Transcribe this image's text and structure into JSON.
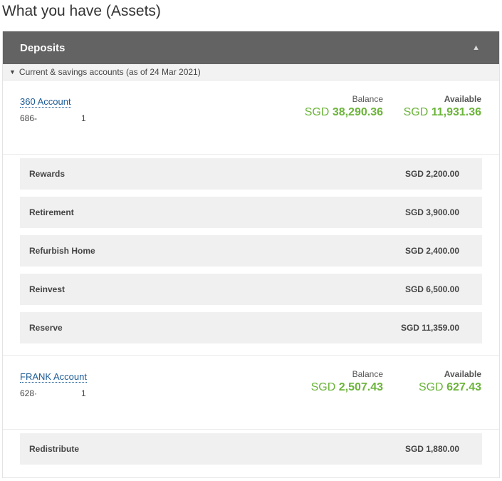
{
  "page": {
    "title": "What you have (Assets)"
  },
  "panel": {
    "title": "Deposits",
    "collapse_icon": "triangle-up-icon"
  },
  "section": {
    "label": "Current & savings accounts (as of 24 Mar 2021)",
    "expand_icon": "triangle-down-icon"
  },
  "colors": {
    "accent_green": "#6bb43a",
    "link_blue": "#1a5a96",
    "header_gray": "#636363"
  },
  "accounts": [
    {
      "name": "360 Account",
      "number_prefix": "686-",
      "number_suffix": "1",
      "balance_label": "Balance",
      "available_label": "Available",
      "balance_currency": "SGD",
      "balance_amount": "38,290.36",
      "available_currency": "SGD",
      "available_amount": "11,931.36",
      "goals": [
        {
          "label": "Rewards",
          "amount": "SGD 2,200.00"
        },
        {
          "label": "Retirement",
          "amount": "SGD 3,900.00"
        },
        {
          "label": "Refurbish Home",
          "amount": "SGD 2,400.00"
        },
        {
          "label": "Reinvest",
          "amount": "SGD 6,500.00"
        },
        {
          "label": "Reserve",
          "amount": "SGD 11,359.00"
        }
      ]
    },
    {
      "name": "FRANK Account",
      "number_prefix": "628·",
      "number_suffix": "1",
      "balance_label": "Balance",
      "available_label": "Available",
      "balance_currency": "SGD",
      "balance_amount": "2,507.43",
      "available_currency": "SGD",
      "available_amount": "627.43",
      "goals": [
        {
          "label": "Redistribute",
          "amount": "SGD 1,880.00"
        }
      ]
    }
  ]
}
